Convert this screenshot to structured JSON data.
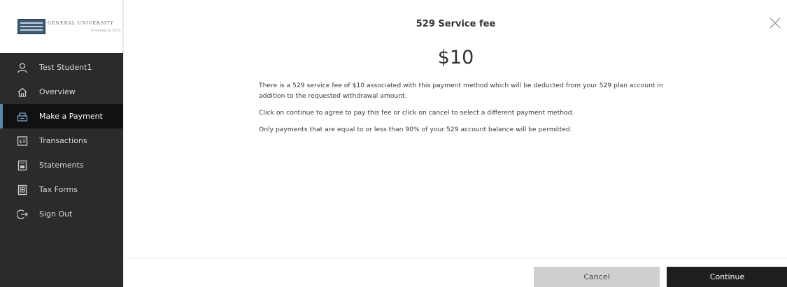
{
  "logo": {
    "name": "GENERAL UNIVERSITY",
    "subtitle": "Founded in 1933"
  },
  "sidebar": {
    "items": [
      {
        "label": "Test Student1",
        "icon": "user-icon",
        "active": false
      },
      {
        "label": "Overview",
        "icon": "home-icon",
        "active": false
      },
      {
        "label": "Make a Payment",
        "icon": "payment-icon",
        "active": true
      },
      {
        "label": "Transactions",
        "icon": "transactions-icon",
        "active": false
      },
      {
        "label": "Statements",
        "icon": "statements-icon",
        "active": false
      },
      {
        "label": "Tax Forms",
        "icon": "tax-forms-icon",
        "active": false
      },
      {
        "label": "Sign Out",
        "icon": "sign-out-icon",
        "active": false
      }
    ]
  },
  "modal": {
    "title": "529 Service fee",
    "amount": "$10",
    "paragraphs": [
      "There is a 529 service fee of $10 associated with this payment method which will be deducted from your 529 plan account in addition to the requested withdrawal amount.",
      "Click on continue to agree to pay this fee or click on cancel to select a different payment method.",
      "Only payments that are equal to or less than 90% of your 529 account balance will be permitted."
    ],
    "cancel_label": "Cancel",
    "continue_label": "Continue"
  },
  "colors": {
    "sidebar_bg": "#2b2b2b",
    "active_bg": "#111111",
    "active_accent": "#5a87ad",
    "cancel_bg": "#cfcfcf",
    "continue_bg": "#1f1f1f"
  }
}
